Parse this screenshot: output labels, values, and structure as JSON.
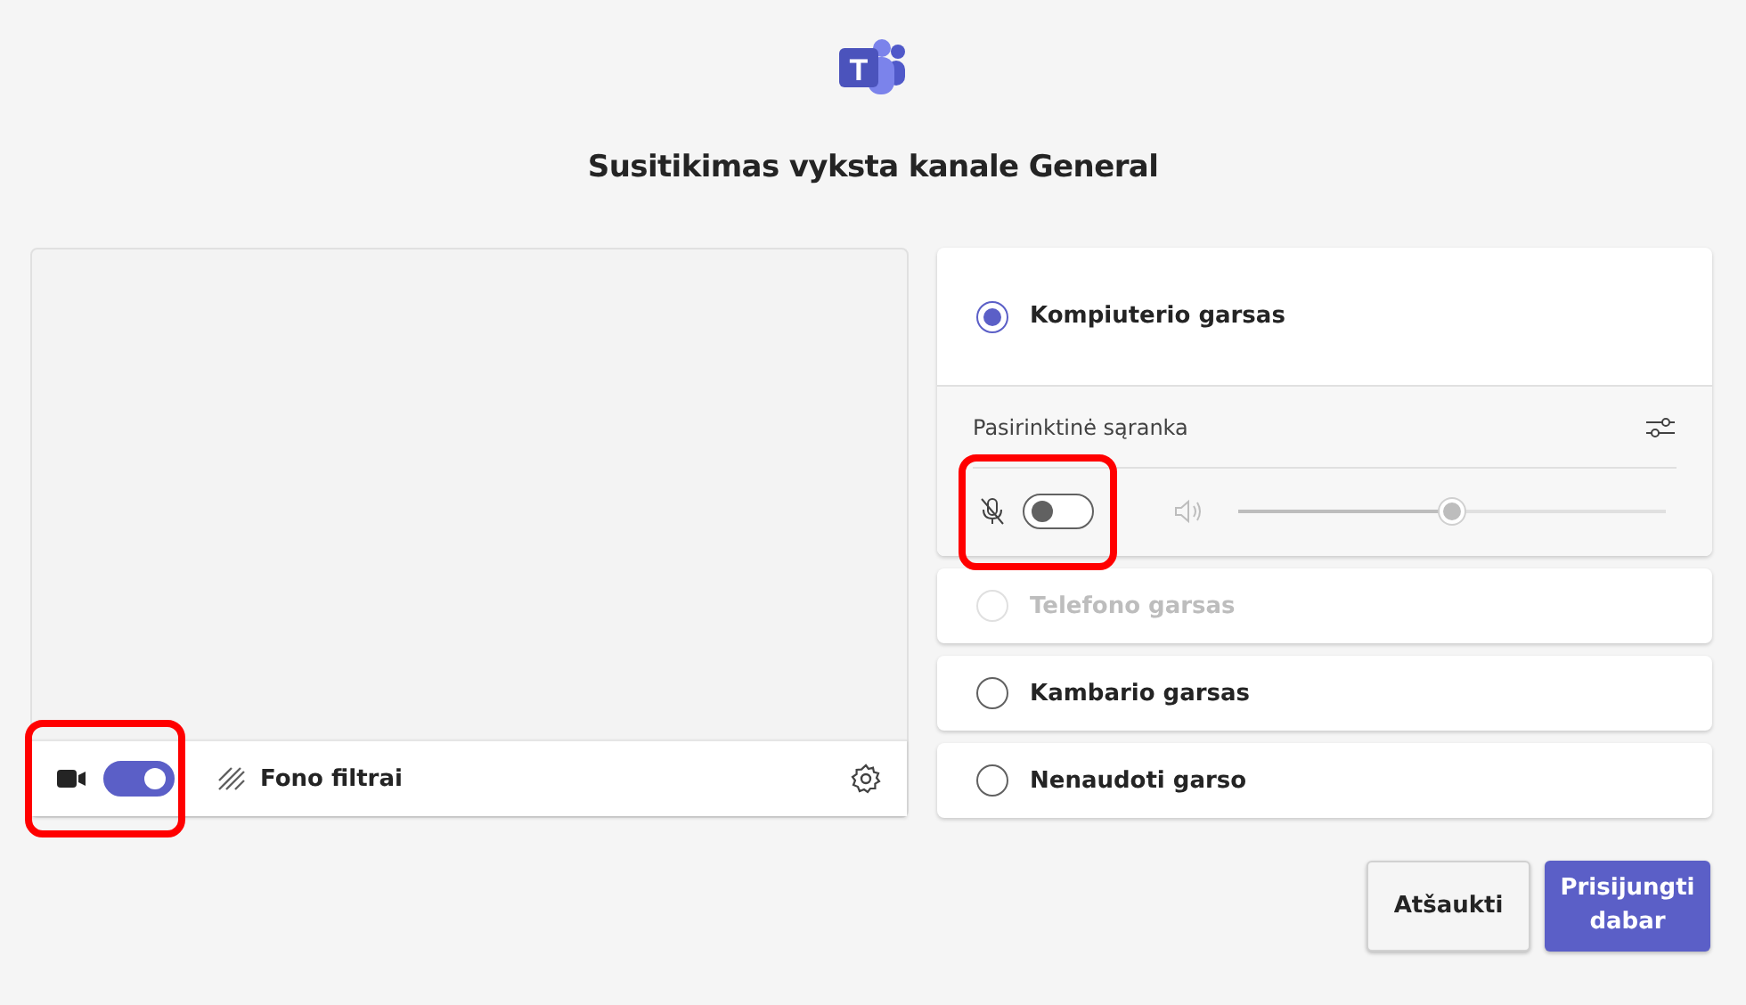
{
  "logo_letter": "T",
  "title": "Susitikimas vyksta kanale General",
  "video": {
    "camera_toggle": {
      "on": true,
      "highlighted": true
    },
    "background_filters": "Fono filtrai"
  },
  "audio_options": [
    {
      "label": "Kompiuterio garsas",
      "selected": true,
      "disabled": false,
      "settings": {
        "label": "Pasirinktinė sąranka",
        "mic_toggle": {
          "on": false,
          "highlighted": true
        },
        "speaker_volume": {
          "level": 0.5
        }
      }
    },
    {
      "label": "Telefono garsas",
      "selected": false,
      "disabled": true
    },
    {
      "label": "Kambario garsas",
      "selected": false,
      "disabled": false
    },
    {
      "label": "Nenaudoti garso",
      "selected": false,
      "disabled": false
    }
  ],
  "buttons": [
    {
      "label": "Atšaukti",
      "kind": "secondary"
    },
    {
      "label": "Prisijungti dabar",
      "kind": "primary"
    }
  ]
}
